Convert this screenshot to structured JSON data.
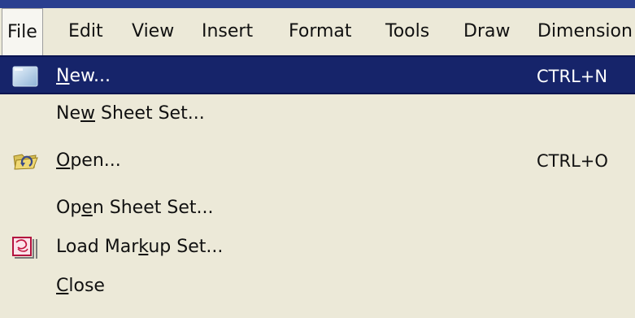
{
  "colors": {
    "menu_background": "#ece9d8",
    "selection_background": "#16246a",
    "selection_text": "#ffffff",
    "title_strip": "#2a3f8f"
  },
  "menubar": {
    "items": [
      {
        "label": "File",
        "active": true
      },
      {
        "label": "Edit"
      },
      {
        "label": "View"
      },
      {
        "label": "Insert"
      },
      {
        "label": "Format"
      },
      {
        "label": "Tools"
      },
      {
        "label": "Draw"
      },
      {
        "label": "Dimension"
      }
    ]
  },
  "file_menu": {
    "items": [
      {
        "label": "New...",
        "mnemonic": "N",
        "shortcut": "CTRL+N",
        "icon": "new-document-icon",
        "selected": true
      },
      {
        "label": "New Sheet Set...",
        "mnemonic": "w",
        "shortcut": ""
      },
      {
        "label": "Open...",
        "mnemonic": "O",
        "shortcut": "CTRL+O",
        "icon": "open-folder-icon"
      },
      {
        "label": "Open Sheet Set...",
        "mnemonic": "e",
        "shortcut": ""
      },
      {
        "label": "Load Markup Set...",
        "mnemonic": "k",
        "shortcut": "",
        "icon": "markup-set-icon"
      },
      {
        "label": "Close",
        "mnemonic": "C",
        "shortcut": ""
      }
    ]
  }
}
